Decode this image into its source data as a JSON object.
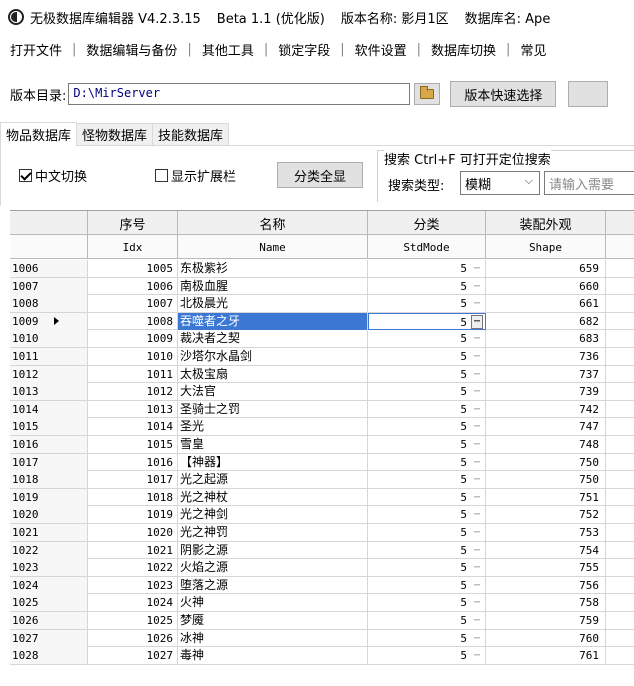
{
  "titlebar": {
    "app_name": "无极数据库编辑器 V4.2.3.15",
    "beta": "Beta 1.1 (优化版)",
    "version_name": "版本名称: 影月1区",
    "db_name": "数据库名: Ape"
  },
  "menu": [
    "打开文件",
    "数据编辑与备份",
    "其他工具",
    "锁定字段",
    "软件设置",
    "数据库切换",
    "常见"
  ],
  "dirbar": {
    "label": "版本目录:",
    "path": "D:\\MirServer",
    "quick_select": "版本快速选择"
  },
  "tabs": [
    "物品数据库",
    "怪物数据库",
    "技能数据库"
  ],
  "toolbar": {
    "chinese_switch": "中文切换",
    "show_ext": "显示扩展栏",
    "show_all": "分类全显",
    "search_legend": "搜索 Ctrl+F 可打开定位搜索",
    "search_type_label": "搜索类型:",
    "search_type_value": "模糊",
    "search_placeholder": "请输入需要"
  },
  "columns": {
    "cn": [
      "序号",
      "名称",
      "分类",
      "装配外观"
    ],
    "en": [
      "Idx",
      "Name",
      "StdMode",
      "Shape"
    ]
  },
  "rows": [
    {
      "rh": "1006",
      "idx": "1005",
      "name": "东极紫衫",
      "std": "5",
      "shape": "659"
    },
    {
      "rh": "1007",
      "idx": "1006",
      "name": "南极血腥",
      "std": "5",
      "shape": "660"
    },
    {
      "rh": "1008",
      "idx": "1007",
      "name": "北极晨光",
      "std": "5",
      "shape": "661"
    },
    {
      "rh": "1009",
      "idx": "1008",
      "name": "吞噬者之牙",
      "std": "5",
      "shape": "682"
    },
    {
      "rh": "1010",
      "idx": "1009",
      "name": "裁决者之契",
      "std": "5",
      "shape": "683"
    },
    {
      "rh": "1011",
      "idx": "1010",
      "name": "沙塔尔水晶剑",
      "std": "5",
      "shape": "736"
    },
    {
      "rh": "1012",
      "idx": "1011",
      "name": "太极宝扇",
      "std": "5",
      "shape": "737"
    },
    {
      "rh": "1013",
      "idx": "1012",
      "name": "大法官",
      "std": "5",
      "shape": "739"
    },
    {
      "rh": "1014",
      "idx": "1013",
      "name": "圣骑士之罚",
      "std": "5",
      "shape": "742"
    },
    {
      "rh": "1015",
      "idx": "1014",
      "name": "圣光",
      "std": "5",
      "shape": "747"
    },
    {
      "rh": "1016",
      "idx": "1015",
      "name": "雪皇",
      "std": "5",
      "shape": "748"
    },
    {
      "rh": "1017",
      "idx": "1016",
      "name": "【神器】",
      "std": "5",
      "shape": "750"
    },
    {
      "rh": "1018",
      "idx": "1017",
      "name": "光之起源",
      "std": "5",
      "shape": "750"
    },
    {
      "rh": "1019",
      "idx": "1018",
      "name": "光之神杖",
      "std": "5",
      "shape": "751"
    },
    {
      "rh": "1020",
      "idx": "1019",
      "name": "光之神剑",
      "std": "5",
      "shape": "752"
    },
    {
      "rh": "1021",
      "idx": "1020",
      "name": "光之神罚",
      "std": "5",
      "shape": "753"
    },
    {
      "rh": "1022",
      "idx": "1021",
      "name": "阴影之源",
      "std": "5",
      "shape": "754"
    },
    {
      "rh": "1023",
      "idx": "1022",
      "name": "火焰之源",
      "std": "5",
      "shape": "755"
    },
    {
      "rh": "1024",
      "idx": "1023",
      "name": "堕落之源",
      "std": "5",
      "shape": "756"
    },
    {
      "rh": "1025",
      "idx": "1024",
      "name": "火神",
      "std": "5",
      "shape": "758"
    },
    {
      "rh": "1026",
      "idx": "1025",
      "name": "梦魇",
      "std": "5",
      "shape": "759"
    },
    {
      "rh": "1027",
      "idx": "1026",
      "name": "冰神",
      "std": "5",
      "shape": "760"
    },
    {
      "rh": "1028",
      "idx": "1027",
      "name": "毒神",
      "std": "5",
      "shape": "761"
    }
  ]
}
